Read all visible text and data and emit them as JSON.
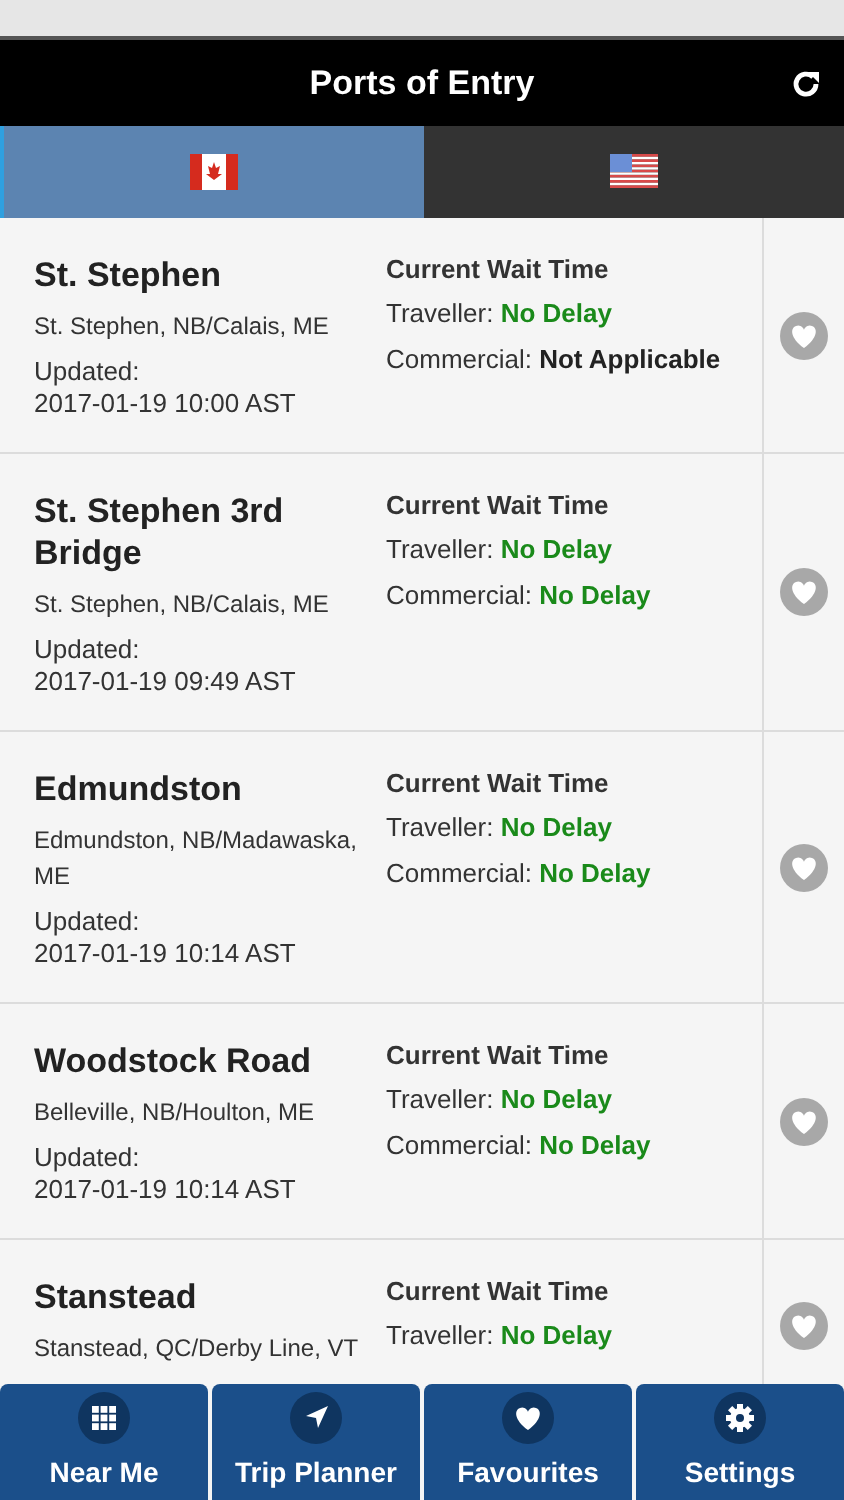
{
  "header": {
    "title": "Ports of Entry"
  },
  "tabs": [
    {
      "kind": "ca",
      "selected": true
    },
    {
      "kind": "us",
      "selected": false
    }
  ],
  "ports": [
    {
      "name": "St. Stephen",
      "location": "St. Stephen, NB/Calais, ME",
      "updated_label": "Updated:",
      "updated": "2017-01-19 10:00 AST",
      "wait_title": "Current Wait Time",
      "traveller_label": "Traveller:",
      "traveller": "No Delay",
      "traveller_highlight": true,
      "commercial_label": "Commercial:",
      "commercial": "Not Applicable",
      "commercial_highlight": false
    },
    {
      "name": "St. Stephen 3rd Bridge",
      "location": "St. Stephen, NB/Calais, ME",
      "updated_label": "Updated:",
      "updated": "2017-01-19 09:49 AST",
      "wait_title": "Current Wait Time",
      "traveller_label": "Traveller:",
      "traveller": "No Delay",
      "traveller_highlight": true,
      "commercial_label": "Commercial:",
      "commercial": "No Delay",
      "commercial_highlight": true
    },
    {
      "name": "Edmundston",
      "location": "Edmundston, NB/Madawaska, ME",
      "updated_label": "Updated:",
      "updated": "2017-01-19 10:14 AST",
      "wait_title": "Current Wait Time",
      "traveller_label": "Traveller:",
      "traveller": "No Delay",
      "traveller_highlight": true,
      "commercial_label": "Commercial:",
      "commercial": "No Delay",
      "commercial_highlight": true
    },
    {
      "name": "Woodstock Road",
      "location": "Belleville, NB/Houlton, ME",
      "updated_label": "Updated:",
      "updated": "2017-01-19 10:14 AST",
      "wait_title": "Current Wait Time",
      "traveller_label": "Traveller:",
      "traveller": "No Delay",
      "traveller_highlight": true,
      "commercial_label": "Commercial:",
      "commercial": "No Delay",
      "commercial_highlight": true
    },
    {
      "name": "Stanstead",
      "location": "Stanstead, QC/Derby Line, VT",
      "wait_title": "Current Wait Time",
      "traveller_label": "Traveller:",
      "traveller": "No Delay",
      "traveller_highlight": true
    }
  ],
  "nav": [
    {
      "kind": "grid",
      "label": "Near Me"
    },
    {
      "kind": "arrow",
      "label": "Trip Planner"
    },
    {
      "kind": "heart",
      "label": "Favourites"
    },
    {
      "kind": "gear",
      "label": "Settings"
    }
  ]
}
